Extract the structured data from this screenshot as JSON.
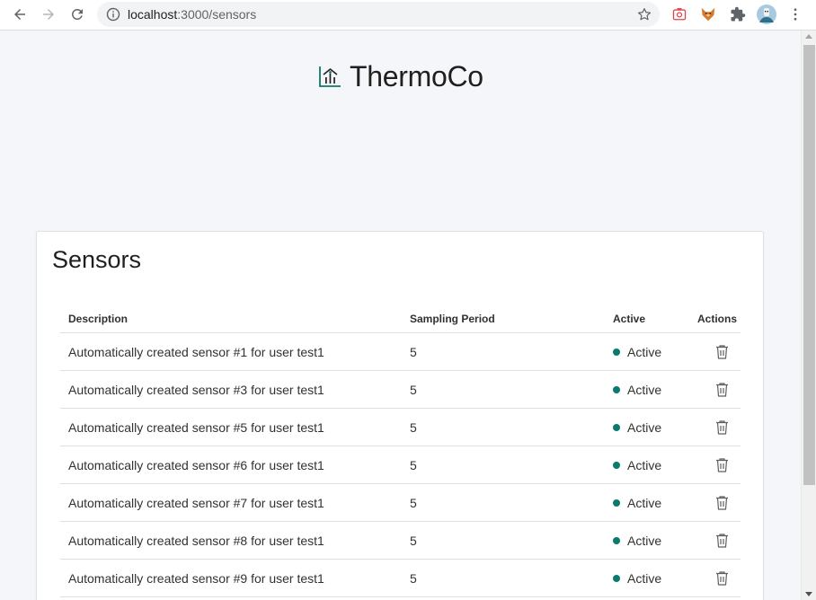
{
  "browser": {
    "url_host": "localhost",
    "url_path": ":3000/sensors",
    "icons": [
      "back-arrow-icon",
      "forward-arrow-icon",
      "reload-icon",
      "info-icon",
      "star-icon",
      "extension-camera-icon",
      "extension-fox-icon",
      "puzzle-icon",
      "profile-avatar",
      "kebab-menu-icon"
    ]
  },
  "brand": {
    "name": "ThermoCo",
    "logo_icon": "chart-home-icon"
  },
  "sensors": {
    "title": "Sensors",
    "columns": {
      "description": "Description",
      "sampling_period": "Sampling Period",
      "active": "Active",
      "actions": "Actions"
    },
    "rows": [
      {
        "description": "Automatically created sensor #1 for user test1",
        "sampling_period": "5",
        "status": "Active"
      },
      {
        "description": "Automatically created sensor #3 for user test1",
        "sampling_period": "5",
        "status": "Active"
      },
      {
        "description": "Automatically created sensor #5 for user test1",
        "sampling_period": "5",
        "status": "Active"
      },
      {
        "description": "Automatically created sensor #6 for user test1",
        "sampling_period": "5",
        "status": "Active"
      },
      {
        "description": "Automatically created sensor #7 for user test1",
        "sampling_period": "5",
        "status": "Active"
      },
      {
        "description": "Automatically created sensor #8 for user test1",
        "sampling_period": "5",
        "status": "Active"
      },
      {
        "description": "Automatically created sensor #9 for user test1",
        "sampling_period": "5",
        "status": "Active"
      }
    ]
  },
  "colors": {
    "accent_teal": "#0b7a6e",
    "page_background": "#f5f6fa",
    "card_background": "#ffffff"
  }
}
